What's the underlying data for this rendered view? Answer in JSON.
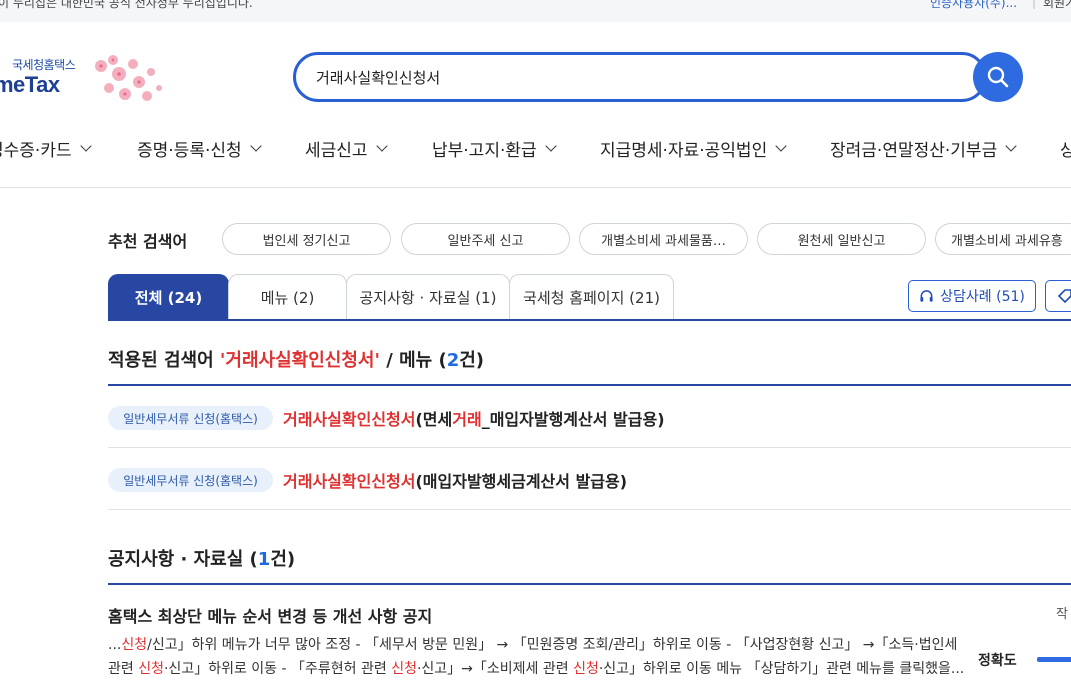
{
  "topbar": {
    "notice": "이 누리집은 대한민국 공식 전자정부 누리집입니다.",
    "cert_link": "인증사용자(주)...",
    "member_link": "회원가입"
  },
  "logo": {
    "small_text": "국세청홈택스",
    "big_text": "HometTax"
  },
  "search": {
    "value": "거래사실확인신청서",
    "button_icon": "search-icon"
  },
  "gnb": {
    "items": [
      {
        "label": "영수증·카드"
      },
      {
        "label": "증명·등록·신청"
      },
      {
        "label": "세금신고"
      },
      {
        "label": "납부·고지·환급"
      },
      {
        "label": "지급명세·자료·공익법인"
      },
      {
        "label": "장려금·연말정산·기부금"
      },
      {
        "label": "상"
      }
    ]
  },
  "recommend": {
    "label": "추천 검색어",
    "chips": [
      "법인세 정기신고",
      "일반주세 신고",
      "개별소비세 과세물품…",
      "원천세 일반신고",
      "개별소비세 과세유흥"
    ]
  },
  "tabs": [
    {
      "label": "전체 (24)"
    },
    {
      "label": "메뉴 (2)"
    },
    {
      "label": "공지사항 · 자료실 (1)"
    },
    {
      "label": "국세청 홈페이지 (21)"
    }
  ],
  "consult_button": "상담사례 (51)",
  "menu_section": {
    "prefix": "적용된 검색어 ",
    "keyword": "'거래사실확인신청서'",
    "middle": " / 메뉴 (",
    "count": "2",
    "suffix": "건)"
  },
  "menu_results": [
    {
      "badge": "일반세무서류 신청(홈택스)",
      "hl1": "거래사실확인신청서",
      "t1": "(면세",
      "hl2": "거래",
      "t2": "_매입자발행계산서 발급용)"
    },
    {
      "badge": "일반세무서류 신청(홈택스)",
      "hl1": "거래사실확인신청서",
      "t1": "(매입자발행세금계산서 발급용)",
      "hl2": "",
      "t2": ""
    }
  ],
  "notice_section": {
    "prefix": "공지사항 · 자료실 (",
    "count": "1",
    "suffix": "건)"
  },
  "notice_item": {
    "title": "홈택스 최상단 메뉴 순서 변경 등 개선 사항 공지",
    "line1_a": "...",
    "line1_hl": "신청",
    "line1_b": "/신고」하위 메뉴가 너무 많아 조정 - 「세무서 방문 민원」 → 「민원증명 조회/관리」하위로 이동 - 「사업장현황 신고」 →「소득·법인세",
    "line2_a": "관련 ",
    "line2_hl1": "신청",
    "line2_b": "·신고」하위로 이동 - 「주류현허 관련 ",
    "line2_hl2": "신청",
    "line2_c": "·신고」→「소비제세 관련 ",
    "line2_hl3": "신청",
    "line2_d": "·신고」하위로 이동 메뉴 「상담하기」관련 메뉴를 클릭했을..."
  },
  "side": {
    "write_label": "작",
    "accuracy_label": "정확도"
  },
  "colors": {
    "primary": "#2747a3",
    "accent": "#2e6be0",
    "highlight": "#e03131"
  }
}
